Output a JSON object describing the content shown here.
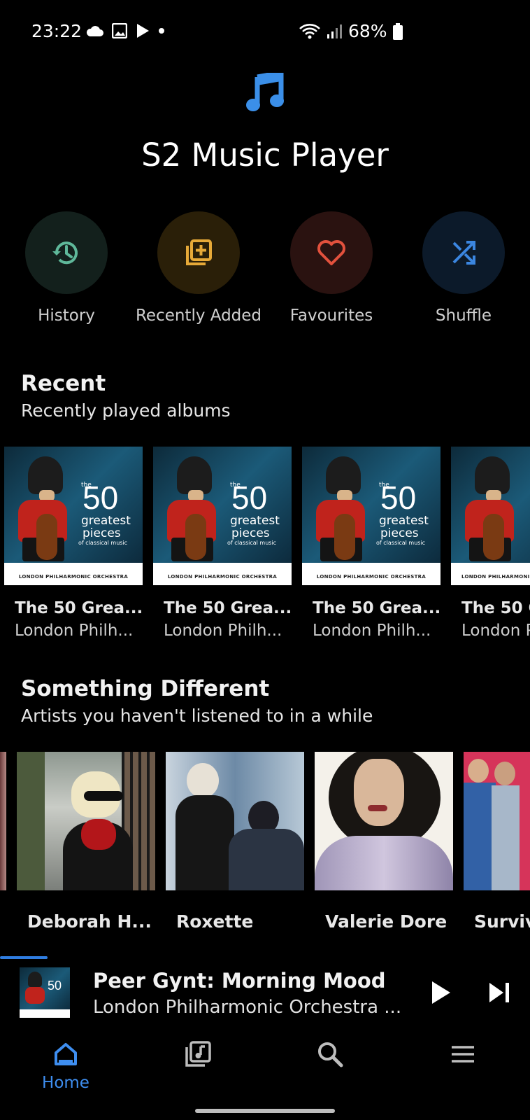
{
  "status_bar": {
    "time": "23:22",
    "battery": "68%",
    "icons": [
      "cloud-icon",
      "image-icon",
      "play-icon",
      "dot-icon",
      "wifi-icon",
      "signal-icon",
      "battery-icon"
    ]
  },
  "header": {
    "title": "S2 Music Player",
    "logo_icon": "music-note-icon"
  },
  "quick_actions": [
    {
      "label": "History",
      "icon": "history-icon",
      "bg": "#13201c",
      "color": "#5fb89a"
    },
    {
      "label": "Recently Added",
      "icon": "playlist-add-icon",
      "bg": "#2a1f08",
      "color": "#e6a938"
    },
    {
      "label": "Favourites",
      "icon": "heart-icon",
      "bg": "#2a1210",
      "color": "#e2513d"
    },
    {
      "label": "Shuffle",
      "icon": "shuffle-icon",
      "bg": "#0c1a2a",
      "color": "#3b86e0"
    }
  ],
  "recent": {
    "title": "Recent",
    "subtitle": "Recently played albums",
    "albums": [
      {
        "title": "The 50 Grea...",
        "artist": "London Philh..."
      },
      {
        "title": "The 50 Grea...",
        "artist": "London Philh..."
      },
      {
        "title": "The 50 Grea...",
        "artist": "London Philh..."
      },
      {
        "title": "The 50 G",
        "artist": "London P"
      }
    ],
    "art_text": {
      "the": "the",
      "number": "50",
      "greatest": "greatest",
      "pieces": "pieces",
      "small": "of classical music",
      "orchestra": "LONDON PHILHARMONIC ORCHESTRA",
      "orchestra_cut": "LONDON PHILHARMONI"
    }
  },
  "something_different": {
    "title": "Something Different",
    "subtitle": "Artists you haven't listened to in a while",
    "artists": [
      {
        "name": "Deborah H..."
      },
      {
        "name": "Roxette"
      },
      {
        "name": "Valerie Dore"
      },
      {
        "name": "Surviv"
      }
    ]
  },
  "now_playing": {
    "title": "Peer Gynt: Morning Mood",
    "artist": "London Philharmonic Orchestra ...",
    "progress": 0.09,
    "accent": "#2f7de0"
  },
  "bottom_nav": {
    "active_label": "Home",
    "items": [
      "home-icon",
      "library-icon",
      "search-icon",
      "menu-icon"
    ],
    "accent": "#3e8ef0"
  }
}
